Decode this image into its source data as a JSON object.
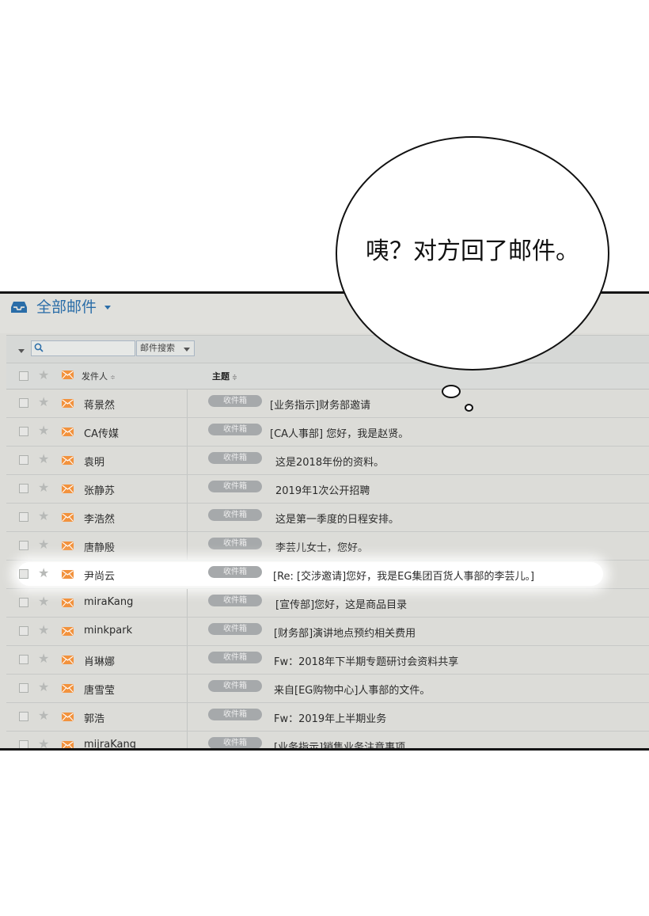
{
  "folder": {
    "title": "全部邮件"
  },
  "toolbar": {
    "search_placeholder": "",
    "search_button_label": "邮件搜索"
  },
  "columns": {
    "sender": "发件人",
    "subject": "主题",
    "sort_glyph": "≑"
  },
  "rows": [
    {
      "sender": "蒋景然",
      "tag": "收件箱",
      "subject": "[业务指示]财务部邀请"
    },
    {
      "sender": "CA传媒",
      "tag": "收件箱",
      "subject": "[CA人事部] 您好，我是赵贤。"
    },
    {
      "sender": "袁明",
      "tag": "收件箱",
      "subject": "这是2018年份的资料。"
    },
    {
      "sender": "张静苏",
      "tag": "收件箱",
      "subject": "2019年1次公开招聘"
    },
    {
      "sender": "李浩然",
      "tag": "收件箱",
      "subject": "这是第一季度的日程安排。"
    },
    {
      "sender": "唐静殷",
      "tag": "收件箱",
      "subject": "李芸儿女士，您好。"
    },
    {
      "sender": "尹尚云",
      "tag": "收件箱",
      "subject": "[Re: [交涉邀请]您好，我是EG集团百货人事部的李芸儿。]"
    },
    {
      "sender": "miraKang",
      "tag": "收件箱",
      "subject": "[宣传部]您好，这是商品目录"
    },
    {
      "sender": "minkpark",
      "tag": "收件箱",
      "subject": "[财务部]演讲地点预约相关费用"
    },
    {
      "sender": "肖琳娜",
      "tag": "收件箱",
      "subject": "Fw：2018年下半期专题研讨会资料共享"
    },
    {
      "sender": "唐雪莹",
      "tag": "收件箱",
      "subject": "来自[EG购物中心]人事部的文件。"
    },
    {
      "sender": "郭浩",
      "tag": "收件箱",
      "subject": "Fw：2019年上半期业务"
    },
    {
      "sender": "mijraKang",
      "tag": "收件箱",
      "subject": "[业务指示]销售业务注意事项"
    }
  ],
  "speech_bubble": {
    "text": "咦？对方回了邮件。"
  },
  "colors": {
    "folder_title": "#2a6da8",
    "mail_icon": "#f2923d",
    "tag_bg": "#a6a9ab"
  }
}
